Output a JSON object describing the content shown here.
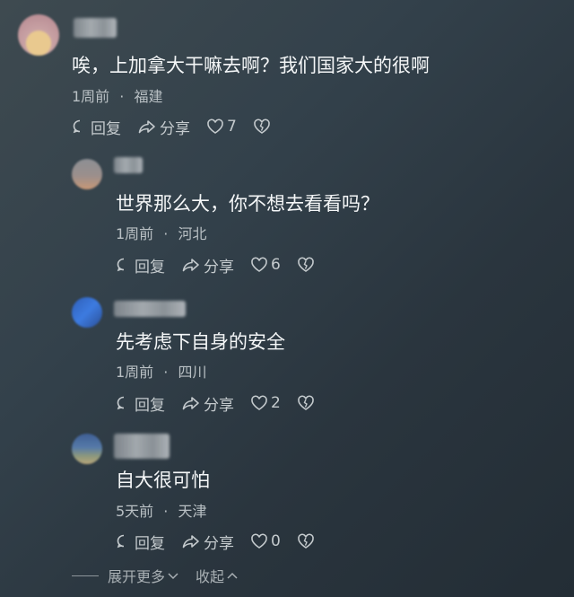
{
  "comments": [
    {
      "text": "唉，上加拿大干嘛去啊？我们国家大的很啊",
      "time": "1周前",
      "location": "福建",
      "reply_label": "回复",
      "share_label": "分享",
      "likes": "7"
    },
    {
      "text": "世界那么大，你不想去看看吗？",
      "time": "1周前",
      "location": "河北",
      "reply_label": "回复",
      "share_label": "分享",
      "likes": "6"
    },
    {
      "text": "先考虑下自身的安全",
      "time": "1周前",
      "location": "四川",
      "reply_label": "回复",
      "share_label": "分享",
      "likes": "2"
    },
    {
      "text": "自大很可怕",
      "time": "5天前",
      "location": "天津",
      "reply_label": "回复",
      "share_label": "分享",
      "likes": "0"
    }
  ],
  "separator": "·",
  "footer": {
    "expand_label": "展开更多",
    "collapse_label": "收起"
  },
  "icons": {
    "reply": "comment-bubble-icon",
    "share": "share-arrow-icon",
    "like": "heart-icon",
    "dislike": "broken-heart-icon",
    "expand": "chevron-down-icon",
    "collapse": "chevron-up-icon"
  },
  "colors": {
    "text": "#f4f6f7",
    "meta": "#b9c0c4",
    "action": "#c4cacd"
  }
}
